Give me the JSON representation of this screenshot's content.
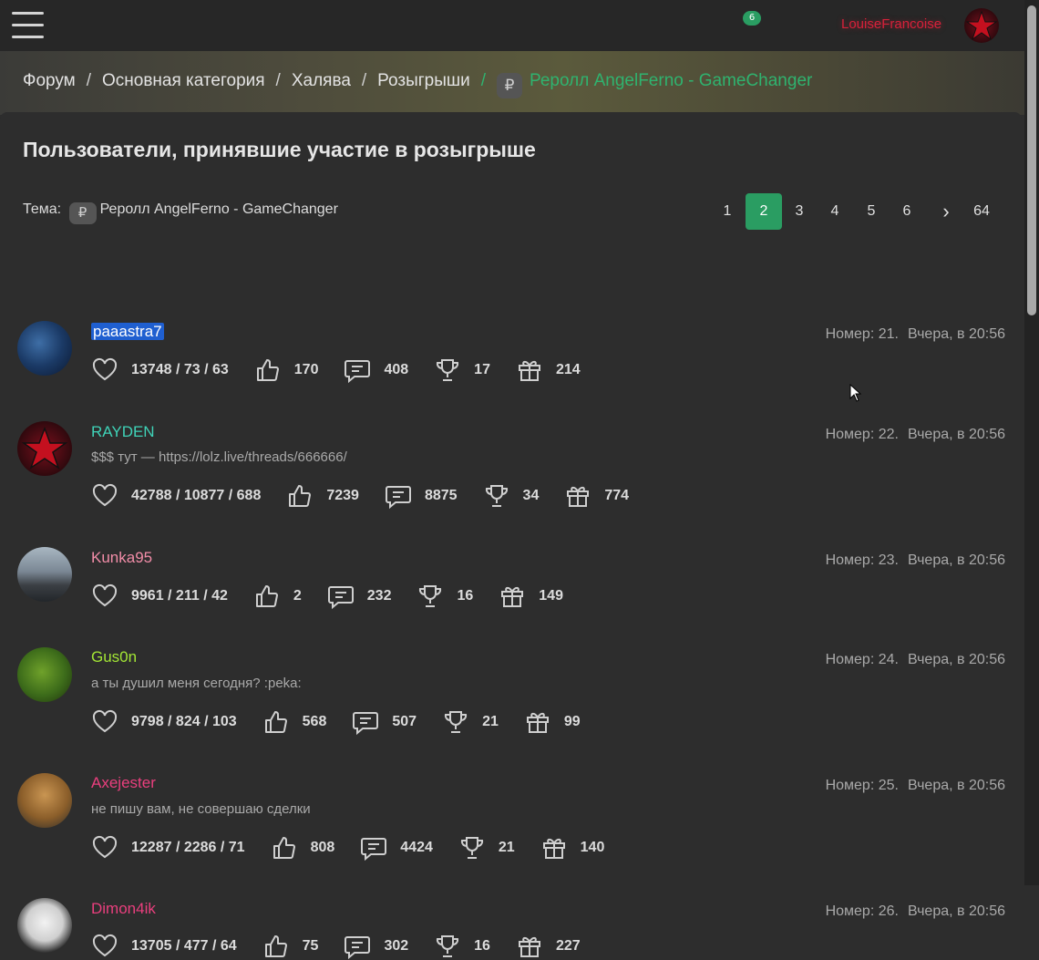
{
  "header": {
    "messages_count": "6",
    "username": "LouiseFrancoise"
  },
  "breadcrumb": {
    "items": [
      "Форум",
      "Основная категория",
      "Халява",
      "Розыгрыши"
    ],
    "current": "Реролл AngelFerno - GameChanger",
    "separator": "/"
  },
  "page": {
    "title": "Пользователи, принявшие участие в розыгрыше",
    "theme_label": "Тема:",
    "theme_prefix": "₽",
    "theme_title": "Реролл AngelFerno - GameChanger"
  },
  "pagination": {
    "pages": [
      "1",
      "2",
      "3",
      "4",
      "5",
      "6"
    ],
    "current": "2",
    "next": "›",
    "last": "64"
  },
  "participants": [
    {
      "name": "paaastra7",
      "name_color": "#ffffff",
      "signature": "",
      "rep": "13748 / 73 / 63",
      "likes": "170",
      "messages": "408",
      "trophies": "17",
      "gifts": "214",
      "number": "Номер: 21.",
      "time": "Вчера, в 20:56"
    },
    {
      "name": "RAYDEN",
      "name_color": "#3fd3b8",
      "signature": "$$$ тут — https://lolz.live/threads/666666/",
      "rep": "42788 / 10877 / 688",
      "likes": "7239",
      "messages": "8875",
      "trophies": "34",
      "gifts": "774",
      "number": "Номер: 22.",
      "time": "Вчера, в 20:56"
    },
    {
      "name": "Kunka95",
      "name_color": "#f28da8",
      "signature": "",
      "rep": "9961 / 211 / 42",
      "likes": "2",
      "messages": "232",
      "trophies": "16",
      "gifts": "149",
      "number": "Номер: 23.",
      "time": "Вчера, в 20:56"
    },
    {
      "name": "Gus0n",
      "name_color": "#a3e635",
      "signature": "а ты душил меня сегодня? :peka:",
      "rep": "9798 / 824 / 103",
      "likes": "568",
      "messages": "507",
      "trophies": "21",
      "gifts": "99",
      "number": "Номер: 24.",
      "time": "Вчера, в 20:56"
    },
    {
      "name": "Axejester",
      "name_color": "#ea3f7e",
      "signature": "не пишу вам, не совершаю сделки",
      "rep": "12287 / 2286 / 71",
      "likes": "808",
      "messages": "4424",
      "trophies": "21",
      "gifts": "140",
      "number": "Номер: 25.",
      "time": "Вчера, в 20:56"
    },
    {
      "name": "Dimon4ik",
      "name_color": "#ea3f7e",
      "signature": "",
      "rep": "13705 / 477 / 64",
      "likes": "75",
      "messages": "302",
      "trophies": "16",
      "gifts": "227",
      "number": "Номер: 26.",
      "time": "Вчера, в 20:56"
    }
  ],
  "colors": {
    "accent": "#2a9d62",
    "breadcrumb_current": "#2fb36f",
    "username_top": "#d6213a"
  },
  "icons": [
    "menu-icon",
    "chat-icon",
    "bell-icon",
    "heart-icon",
    "like-icon",
    "message-icon",
    "trophy-icon",
    "gift-icon"
  ]
}
